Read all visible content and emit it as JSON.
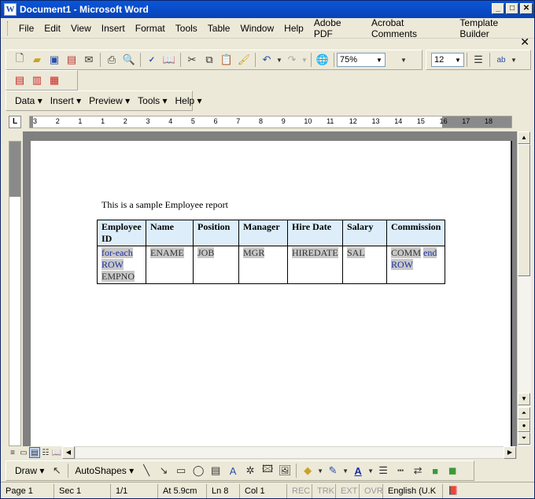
{
  "window": {
    "title": "Document1 - Microsoft Word",
    "app_icon": "W"
  },
  "menu": {
    "items": [
      "File",
      "Edit",
      "View",
      "Insert",
      "Format",
      "Tools",
      "Table",
      "Window",
      "Help",
      "Adobe PDF",
      "Acrobat Comments",
      "Template Builder"
    ]
  },
  "toolbar": {
    "zoom": "75%",
    "font_size": "12"
  },
  "template_toolbar": {
    "items": [
      "Data",
      "Insert",
      "Preview",
      "Tools",
      "Help"
    ]
  },
  "document": {
    "caption": "This is a sample Employee report",
    "table": {
      "headers": [
        "Employee ID",
        "Name",
        "Position",
        "Manager",
        "Hire Date",
        "Salary",
        "Commission"
      ],
      "row": [
        {
          "parts": [
            {
              "text": "for-each ROW",
              "kind": "blue"
            },
            {
              "text": "EMPNO",
              "kind": "field"
            }
          ]
        },
        {
          "parts": [
            {
              "text": "ENAME",
              "kind": "field"
            }
          ]
        },
        {
          "parts": [
            {
              "text": "JOB",
              "kind": "field"
            }
          ]
        },
        {
          "parts": [
            {
              "text": "MGR",
              "kind": "field"
            }
          ]
        },
        {
          "parts": [
            {
              "text": "HIREDATE",
              "kind": "field"
            }
          ]
        },
        {
          "parts": [
            {
              "text": "SAL",
              "kind": "field"
            }
          ]
        },
        {
          "parts": [
            {
              "text": "COMM",
              "kind": "field"
            },
            {
              "text": "end ROW",
              "kind": "blue"
            }
          ]
        }
      ]
    }
  },
  "ruler": {
    "marks": [
      "3",
      "2",
      "1",
      "1",
      "2",
      "3",
      "4",
      "5",
      "6",
      "7",
      "8",
      "9",
      "10",
      "11",
      "12",
      "13",
      "14",
      "15",
      "16",
      "17",
      "18"
    ]
  },
  "drawing": {
    "draw_label": "Draw",
    "autoshapes_label": "AutoShapes"
  },
  "status": {
    "page": "Page  1",
    "sec": "Sec  1",
    "pages": "1/1",
    "at": "At  5.9cm",
    "ln": "Ln  8",
    "col": "Col  1",
    "rec": "REC",
    "trk": "TRK",
    "ext": "EXT",
    "ovr": "OVR",
    "lang": "English (U.K"
  }
}
